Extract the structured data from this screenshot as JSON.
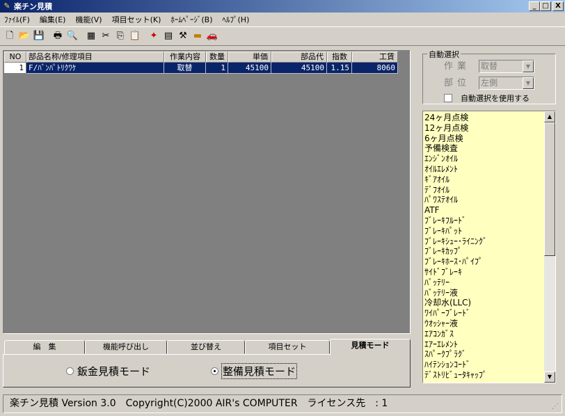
{
  "window": {
    "title": "楽チン見積",
    "icon": "app-icon",
    "controls": {
      "minimize": "_",
      "maximize": "□",
      "close": "X"
    }
  },
  "menu": [
    "ﾌｧｲﾙ(F)",
    "編集(E)",
    "機能(V)",
    "項目セット(K)",
    "ﾎｰﾑﾍﾟｰｼﾞ(B)",
    "ﾍﾙﾌﾟ(H)"
  ],
  "toolbar": {
    "icons": [
      "new-file-icon",
      "open-folder-icon",
      "save-icon",
      "print-icon",
      "print-preview-icon",
      "properties-icon",
      "cut-icon",
      "copy-icon",
      "paste-icon",
      "tool-icon-1",
      "tool-icon-2",
      "tool-icon-3",
      "tool-icon-4",
      "car-icon"
    ],
    "glyphs": [
      "🗋",
      "📂",
      "💾",
      "🖶",
      "🔍",
      "▦",
      "✂",
      "⎘",
      "📋",
      "✦",
      "▤",
      "⚒",
      "▬",
      "🚗"
    ]
  },
  "grid": {
    "headers": [
      "NO",
      "部品名称/修理項目",
      "作業内容",
      "数量",
      "単価",
      "部品代",
      "指数",
      "工賃"
    ],
    "rows": [
      [
        "1",
        "F/ﾊﾞﾝﾊﾟﾄﾘｸﾜｹ",
        "取替",
        "1",
        "45100",
        "45100",
        "1.15",
        "8060"
      ]
    ]
  },
  "tabs": {
    "items": [
      "編　集",
      "機能呼び出し",
      "並び替え",
      "項目セット",
      "見積モード"
    ],
    "active_index": 4,
    "mode_options": [
      {
        "label": "鈑金見積モード",
        "selected": false
      },
      {
        "label": "整備見積モード",
        "selected": true
      }
    ]
  },
  "auto_select": {
    "legend": "自動選択",
    "work_label": "作業",
    "work_value": "取替",
    "part_label": "部位",
    "part_value": "左側",
    "checkbox_label": "自動選択を使用する",
    "checked": false
  },
  "item_list": [
    "24ヶ月点検",
    "12ヶ月点検",
    "6ヶ月点検",
    "予備検査",
    "ｴﾝｼﾞﾝｵｲﾙ",
    "ｵｲﾙｴﾚﾒﾝﾄ",
    "ｷﾞｱｵｲﾙ",
    "ﾃﾞﾌｵｲﾙ",
    "ﾊﾟﾜｽﾃｵｲﾙ",
    "ATF",
    "ﾌﾞﾚｰｷﾌﾙｰﾄﾞ",
    "ﾌﾞﾚｰｷﾊﾟｯﾄ",
    "ﾌﾞﾚｰｷｼｭｰ･ﾗｲﾆﾝｸﾞ",
    "ﾌﾞﾚｰｷｶｯﾌﾟ",
    "ﾌﾞﾚｰｷﾎｰｽ･ﾊﾟｲﾌﾟ",
    "ｻｲﾄﾞﾌﾞﾚｰｷ",
    "ﾊﾞｯﾃﾘｰ",
    "ﾊﾞｯﾃﾘｰ液",
    "冷却水(LLC)",
    "ﾜｲﾊﾟｰﾌﾞﾚｰﾄﾞ",
    "ｳｵｯｼｬｰ液",
    "ｴｱｺﾝｶﾞｽ",
    "ｴｱｰｴﾚﾒﾝﾄ",
    "ｽﾊﾟｰｸﾌﾟﾗｸﾞ",
    "ﾊｲﾃﾝｼｮﾝｺｰﾄﾞ",
    "ﾃﾞｽﾄﾘﾋﾞｭｰﾀｷｬｯﾌﾟ"
  ],
  "status_bar": "楽チン見積 Version 3.0　Copyright(C)2000 AIR's COMPUTER　ライセンス先　: 1"
}
